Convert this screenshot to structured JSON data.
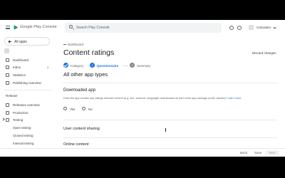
{
  "topbar": {
    "brand_google": "Google Play",
    "brand_console": "Console",
    "search_placeholder": "Search Play Console",
    "account_name": "Calculator"
  },
  "sidebar": {
    "all_apps": "All apps",
    "items": [
      {
        "label": "Dashboard",
        "icon": "dashboard-icon"
      },
      {
        "label": "Inbox",
        "icon": "inbox-icon",
        "badge": "3"
      },
      {
        "label": "Statistics",
        "icon": "statistics-icon"
      },
      {
        "label": "Publishing overview",
        "icon": "publishing-icon"
      }
    ],
    "release_section": "Release",
    "release_items": [
      {
        "label": "Releases overview",
        "icon": "releases-icon"
      },
      {
        "label": "Production",
        "icon": "production-icon"
      },
      {
        "label": "Testing",
        "icon": "testing-icon"
      }
    ],
    "testing_sub": [
      {
        "label": "Open testing"
      },
      {
        "label": "Closed testing"
      },
      {
        "label": "Internal testing"
      }
    ]
  },
  "main": {
    "breadcrumb": "Dashboard",
    "title": "Content ratings",
    "discard": "Discard changes",
    "steps": [
      {
        "label": "Category",
        "state": "done"
      },
      {
        "label": "Questionnaire",
        "state": "active",
        "num": "2"
      },
      {
        "label": "Summary",
        "state": "pending",
        "num": "3"
      }
    ],
    "section_heading": "All other app types",
    "downloaded_heading": "Downloaded app",
    "question": "Does the app contain any ratings-relevant content (e.g. sex, violence, language) downloaded as part of the app package (code, assets)?",
    "learn_more": "Learn more",
    "yes_label": "Yes",
    "no_label": "No",
    "ucs_heading": "User content sharing",
    "online_heading": "Online content"
  },
  "bottombar": {
    "back": "Back",
    "save": "Save",
    "next": "Next"
  },
  "colors": {
    "accent": "#1a73e8",
    "text": "#202124",
    "muted": "#5f6368"
  }
}
